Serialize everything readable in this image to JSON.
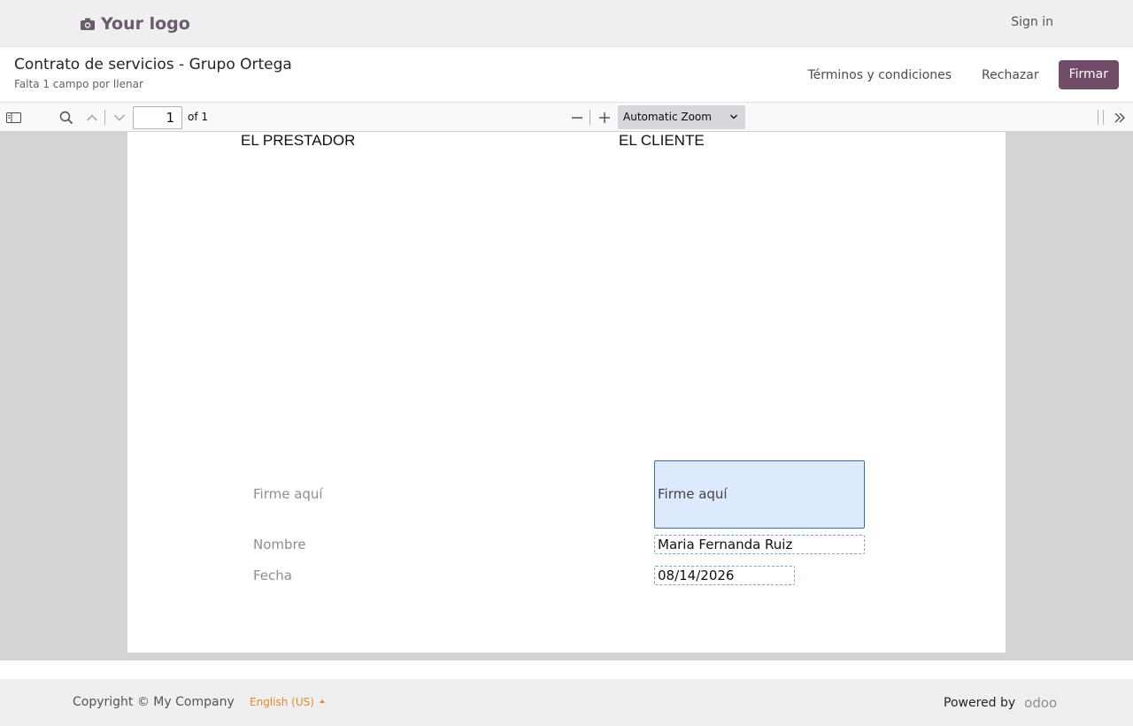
{
  "header": {
    "logo_text": "Your logo",
    "signin_label": "Sign in"
  },
  "document": {
    "title": "Contrato de servicios - Grupo Ortega",
    "subtitle": "Falta 1 campo por llenar",
    "actions": {
      "terms_label": "Términos y condiciones",
      "reject_label": "Rechazar",
      "sign_label": "Firmar"
    },
    "brand_color": "#714b67"
  },
  "pdf_toolbar": {
    "current_page": "1",
    "page_count_label": "of 1",
    "zoom_label": "Automatic Zoom"
  },
  "page": {
    "party_left": "EL PRESTADOR",
    "party_right": "EL CLIENTE",
    "labels": {
      "signature": "Firme aquí",
      "name": "Nombre",
      "date": "Fecha"
    },
    "fields": {
      "signature_placeholder": "Firme aquí",
      "name_value": "Maria Fernanda Ruiz",
      "date_value": "08/14/2026"
    }
  },
  "footer": {
    "copyright": "Copyright © My Company",
    "language": "English (US)",
    "powered_by": "Powered by",
    "powered_brand": "odoo",
    "language_color": "#e08a2f"
  }
}
